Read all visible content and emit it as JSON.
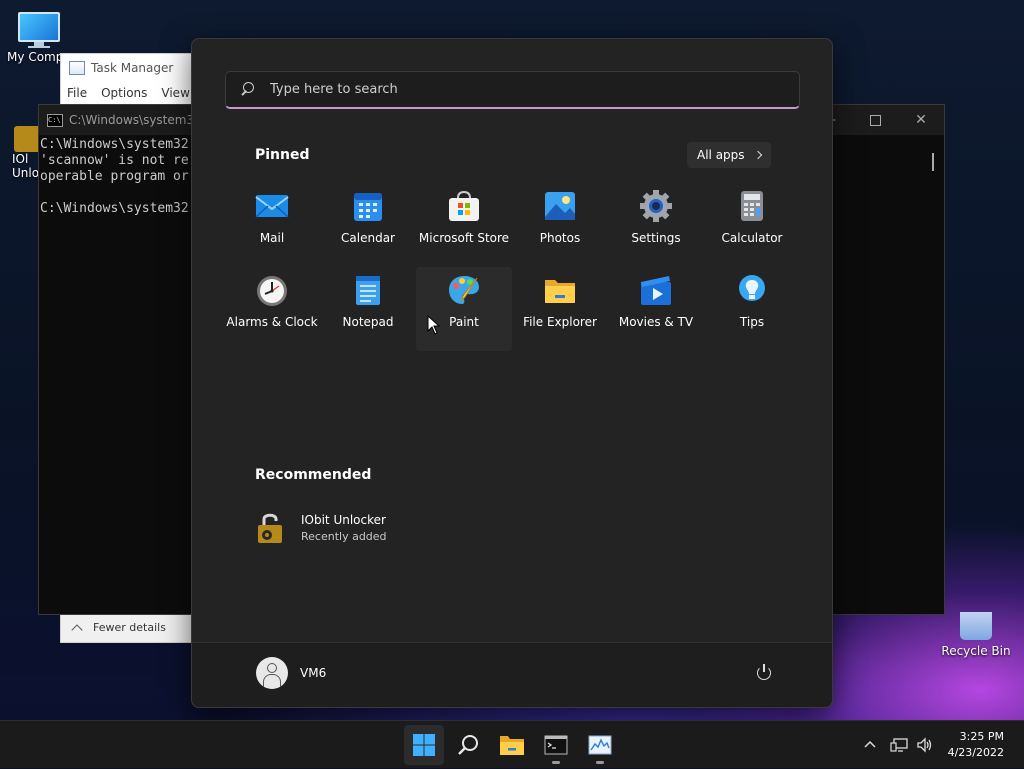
{
  "desktop": {
    "icons": [
      {
        "label": "My Compu"
      },
      {
        "label": "IOl\nUnlo"
      },
      {
        "label": "Recycle Bin"
      }
    ]
  },
  "taskmgr": {
    "title": "Task Manager",
    "menu": [
      "File",
      "Options",
      "View"
    ],
    "fewer_details": "Fewer details"
  },
  "cmd": {
    "title": "C:\\Windows\\system32\\",
    "lines": [
      "C:\\Windows\\system32",
      "'scannow' is not re",
      "operable program or",
      "",
      "C:\\Windows\\system32"
    ]
  },
  "start_menu": {
    "search_placeholder": "Type here to search",
    "pinned_title": "Pinned",
    "all_apps_label": "All apps",
    "pinned": [
      {
        "label": "Mail",
        "icon": "mail-icon"
      },
      {
        "label": "Calendar",
        "icon": "calendar-icon"
      },
      {
        "label": "Microsoft Store",
        "icon": "store-icon"
      },
      {
        "label": "Photos",
        "icon": "photos-icon"
      },
      {
        "label": "Settings",
        "icon": "gear-icon"
      },
      {
        "label": "Calculator",
        "icon": "calculator-icon"
      },
      {
        "label": "Alarms & Clock",
        "icon": "clock-icon"
      },
      {
        "label": "Notepad",
        "icon": "notepad-icon"
      },
      {
        "label": "Paint",
        "icon": "paint-icon"
      },
      {
        "label": "File Explorer",
        "icon": "folder-icon"
      },
      {
        "label": "Movies & TV",
        "icon": "movies-icon"
      },
      {
        "label": "Tips",
        "icon": "lightbulb-icon"
      }
    ],
    "recommended_title": "Recommended",
    "recommended": [
      {
        "name": "IObit Unlocker",
        "subtitle": "Recently added",
        "icon": "unlock-icon"
      }
    ],
    "user": {
      "name": "VM6"
    }
  },
  "taskbar": {
    "clock_time": "3:25 PM",
    "clock_date": "4/23/2022"
  }
}
